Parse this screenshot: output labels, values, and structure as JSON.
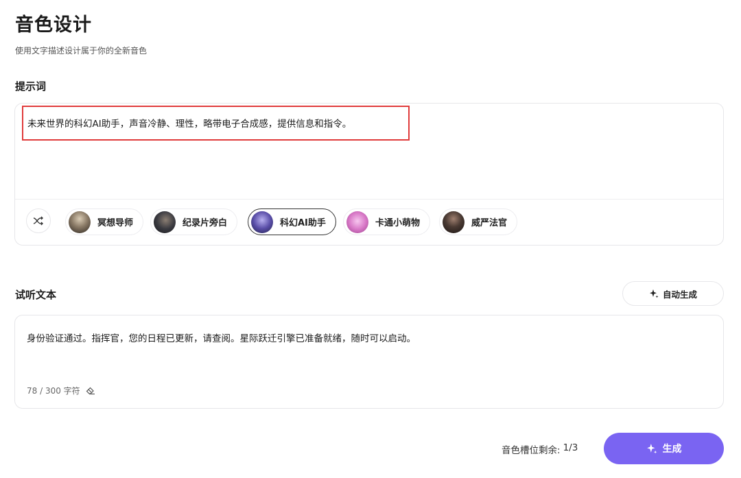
{
  "header": {
    "title": "音色设计",
    "subtitle": "使用文字描述设计属于你的全新音色"
  },
  "prompt": {
    "label": "提示词",
    "text": "未来世界的科幻AI助手，声音冷静、理性，略带电子合成感，提供信息和指令。",
    "shuffle_icon": "shuffle-icon",
    "presets": [
      {
        "label": "冥想导师",
        "avatar_color": "#8a7a66",
        "selected": false
      },
      {
        "label": "纪录片旁白",
        "avatar_color": "#3a3a40",
        "selected": false
      },
      {
        "label": "科幻AI助手",
        "avatar_color": "#5a4ea8",
        "selected": true
      },
      {
        "label": "卡通小萌物",
        "avatar_color": "#d97ac8",
        "selected": false
      },
      {
        "label": "威严法官",
        "avatar_color": "#4a3a33",
        "selected": false
      }
    ]
  },
  "preview": {
    "label": "试听文本",
    "auto_generate_label": "自动生成",
    "text": "身份验证通过。指挥官，您的日程已更新，请查阅。星际跃迁引擎已准备就绪，随时可以启动。",
    "char_count": "78 / 300 字符"
  },
  "footer": {
    "slots_label": "音色槽位剩余:",
    "slots_value": "1/3",
    "generate_label": "生成"
  },
  "colors": {
    "accent": "#7a64f2",
    "highlight": "#e03a3a"
  }
}
